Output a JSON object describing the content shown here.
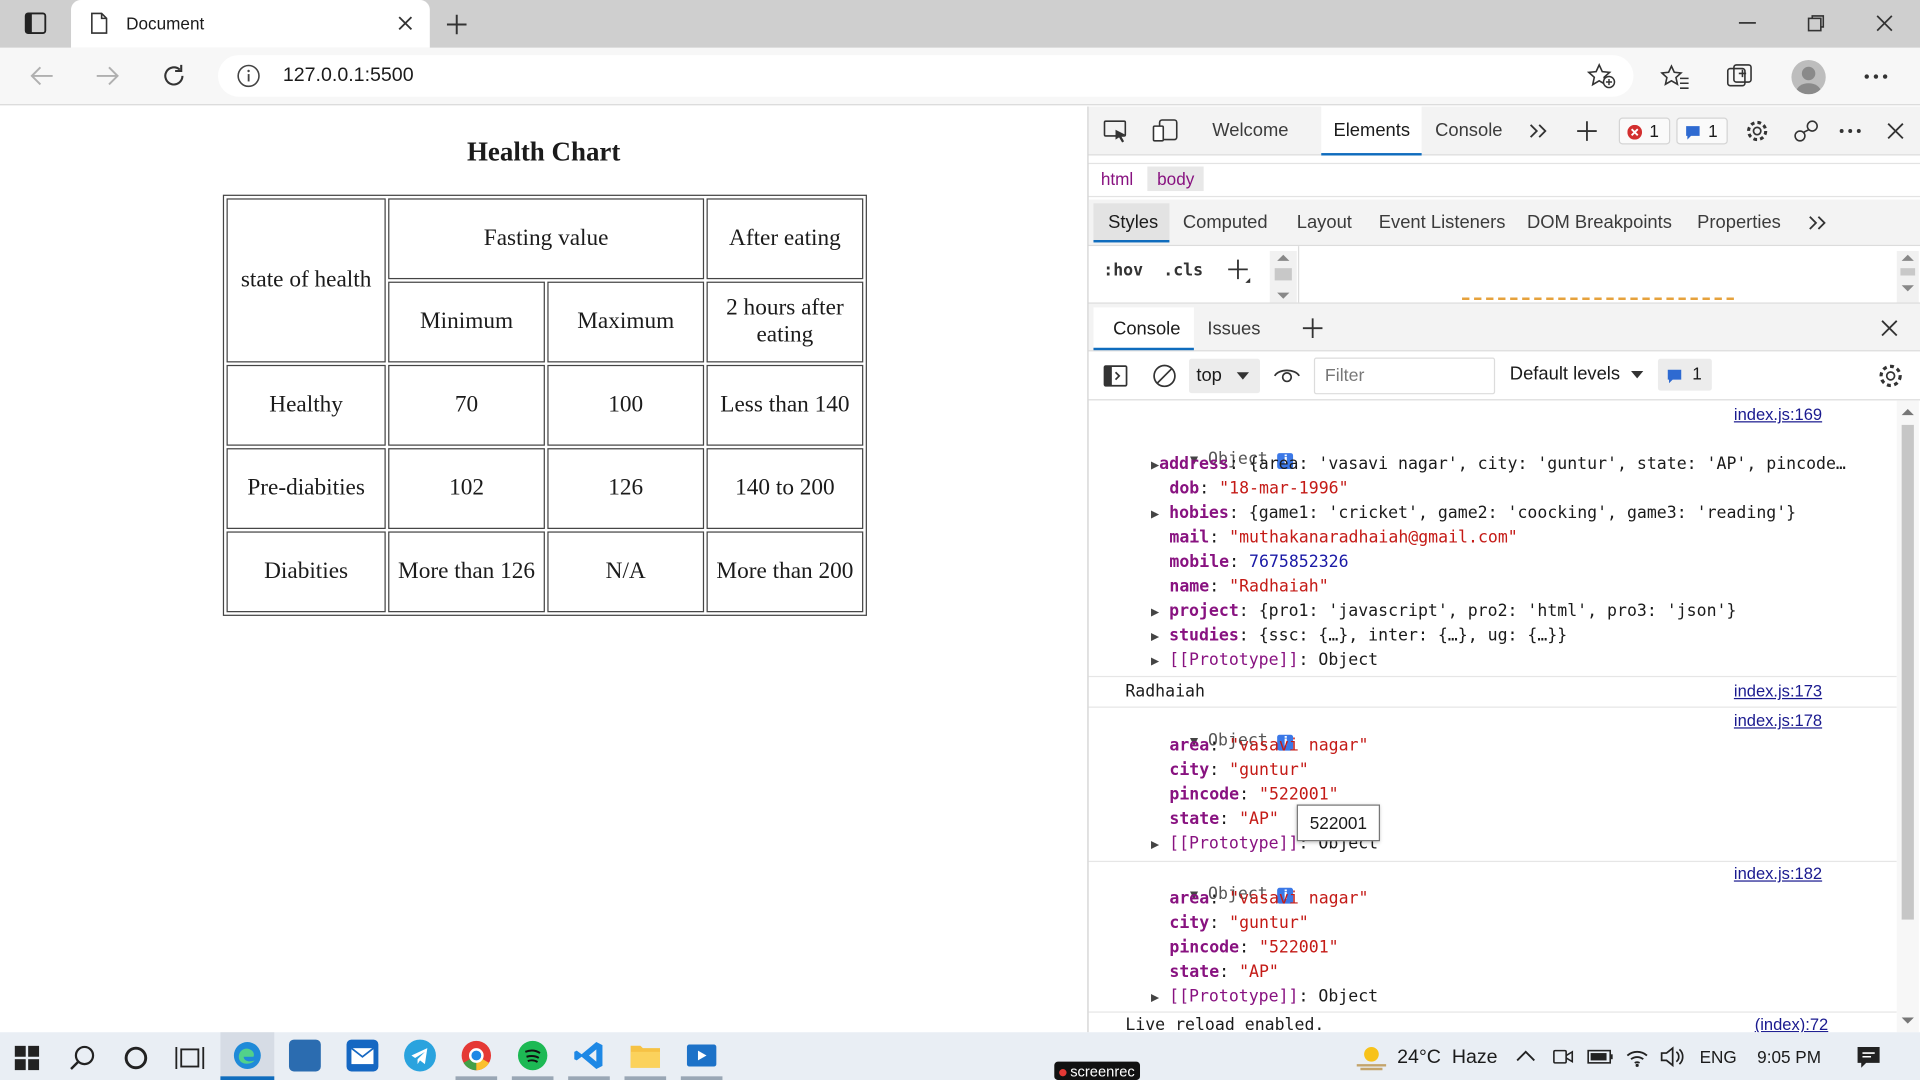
{
  "browser": {
    "tab_title": "Document",
    "url": "127.0.0.1:5500"
  },
  "page": {
    "title": "Health Chart",
    "table": {
      "header_state": "state of health",
      "header_fasting": "Fasting value",
      "header_after": "After eating",
      "sub_min": "Minimum",
      "sub_max": "Maximum",
      "sub_after": "2 hours after eating",
      "rows": [
        {
          "state": "Healthy",
          "min": "70",
          "max": "100",
          "after": "Less than 140"
        },
        {
          "state": "Pre-diabities",
          "min": "102",
          "max": "126",
          "after": "140 to 200"
        },
        {
          "state": "Diabities",
          "min": "More than 126",
          "max": "N/A",
          "after": "More than 200"
        }
      ]
    }
  },
  "devtools": {
    "tabs": [
      "Welcome",
      "Elements",
      "Console"
    ],
    "error_count": "1",
    "message_count": "1",
    "breadcrumb": [
      "html",
      "body"
    ],
    "style_tabs": [
      "Styles",
      "Computed",
      "Layout",
      "Event Listeners",
      "DOM Breakpoints",
      "Properties"
    ],
    "hov": ":hov",
    "cls": ".cls",
    "drawer_tabs": [
      "Console",
      "Issues"
    ],
    "context": "top",
    "filter_placeholder": "Filter",
    "levels": "Default levels",
    "level_count": "1",
    "tooltip": "522001",
    "console": {
      "log1_link": "index.js:169",
      "log1_head": "Object",
      "address_key": "address",
      "address_val": "{area: 'vasavi nagar', city: 'guntur', state: 'AP', pincode…",
      "dob_key": "dob",
      "dob_val": "\"18-mar-1996\"",
      "hobies_key": "hobies",
      "hobies_val": "{game1: 'cricket', game2: 'coocking', game3: 'reading'}",
      "mail_key": "mail",
      "mail_val": "\"muthakanaradhaiah@gmail.com\"",
      "mobile_key": "mobile",
      "mobile_val": "7675852326",
      "name_key": "name",
      "name_val": "\"Radhaiah\"",
      "project_key": "project",
      "project_val": "{pro1: 'javascript', pro2: 'html', pro3: 'json'}",
      "studies_key": "studies",
      "studies_val": "{ssc: {…}, inter: {…}, ug: {…}}",
      "proto_key": "[[Prototype]]",
      "proto_val": "Object",
      "log2_text": "Radhaiah",
      "log2_link": "index.js:173",
      "log3_link": "index.js:178",
      "log4_link": "index.js:182",
      "area_key": "area",
      "area_val": "\"vasavi nagar\"",
      "city_key": "city",
      "city_val": "\"guntur\"",
      "pincode_key": "pincode",
      "pincode_val": "\"522001\"",
      "state_key": "state",
      "state_val": "\"AP\"",
      "log5_text": "Live reload enabled.",
      "log5_link": "(index):72"
    }
  },
  "taskbar": {
    "weather": "24°C  Haze",
    "lang": "ENG",
    "time": "9:05 PM",
    "recorder": "screenrec"
  }
}
